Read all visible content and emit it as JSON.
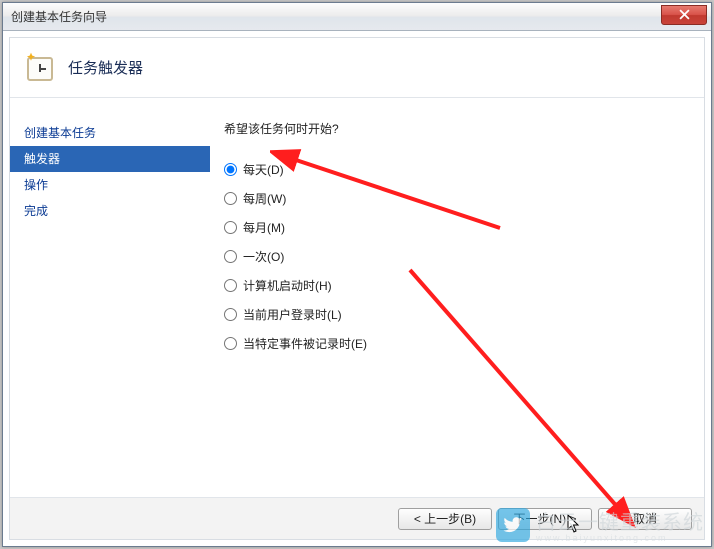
{
  "window": {
    "title": "创建基本任务向导"
  },
  "header": {
    "title": "任务触发器"
  },
  "sidebar": {
    "steps": [
      {
        "label": "创建基本任务",
        "active": false
      },
      {
        "label": "触发器",
        "active": true
      },
      {
        "label": "操作",
        "active": false
      },
      {
        "label": "完成",
        "active": false
      }
    ]
  },
  "content": {
    "prompt": "希望该任务何时开始?",
    "options": [
      {
        "label": "每天(D)",
        "selected": true
      },
      {
        "label": "每周(W)",
        "selected": false
      },
      {
        "label": "每月(M)",
        "selected": false
      },
      {
        "label": "一次(O)",
        "selected": false
      },
      {
        "label": "计算机启动时(H)",
        "selected": false
      },
      {
        "label": "当前用户登录时(L)",
        "selected": false
      },
      {
        "label": "当特定事件被记录时(E)",
        "selected": false
      }
    ]
  },
  "footer": {
    "back": "< 上一步(B)",
    "next": "下一步(N) >",
    "cancel": "取消"
  },
  "watermark": {
    "line1": "白云一键重装系统",
    "line2": "www.baiyunxitong.com"
  }
}
